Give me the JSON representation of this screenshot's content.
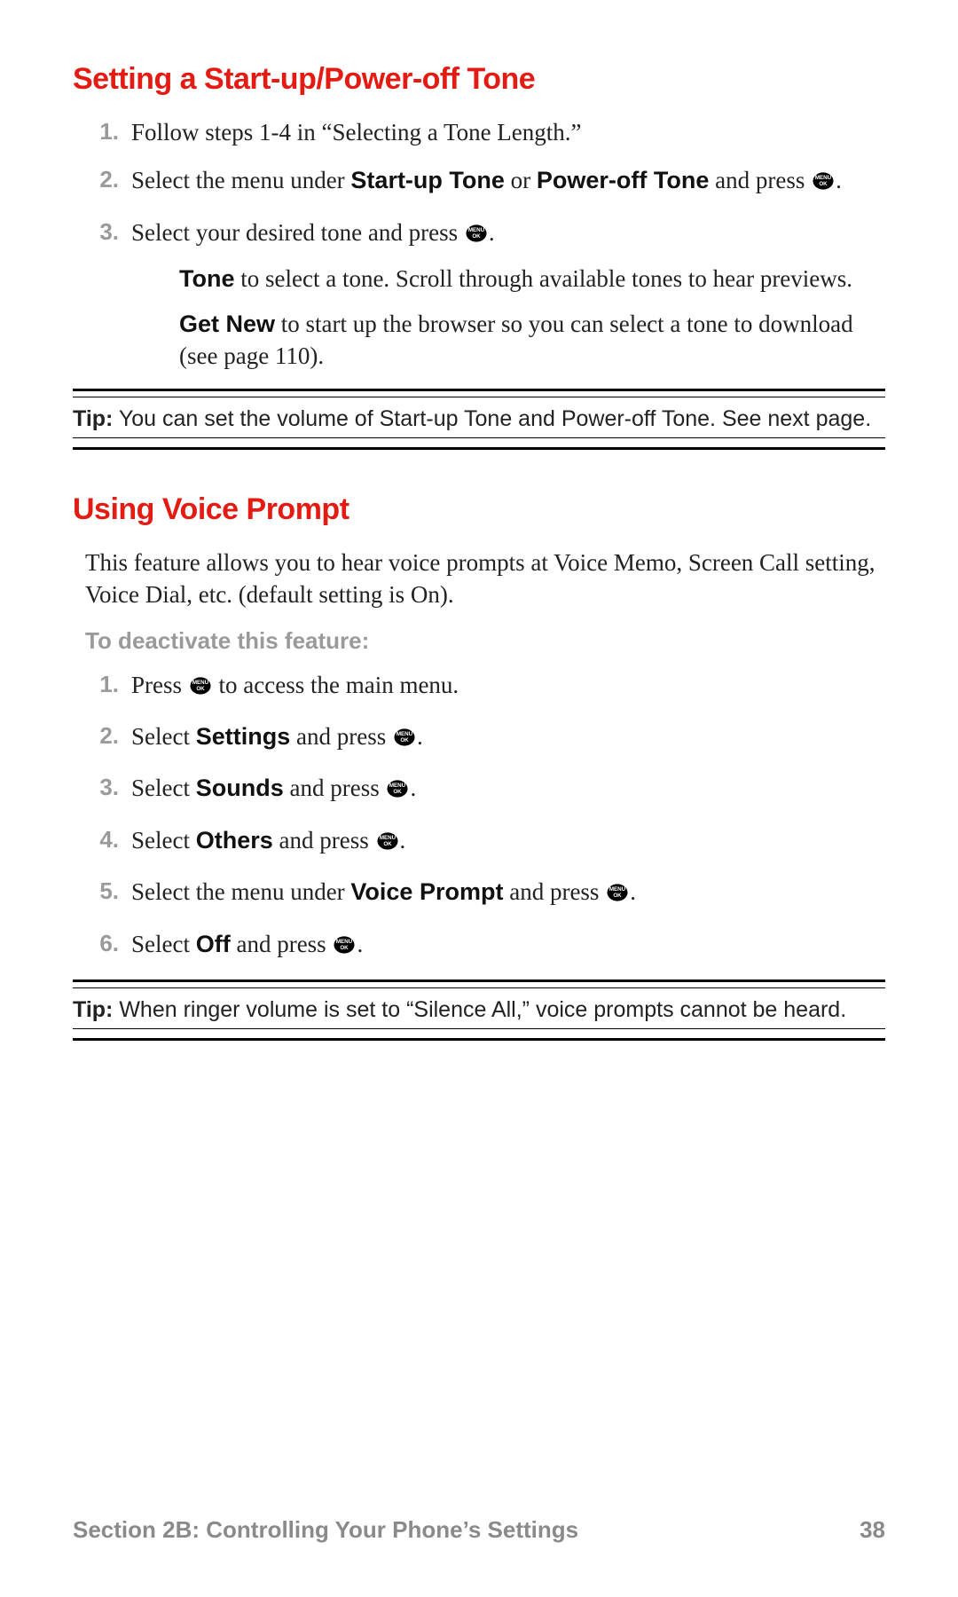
{
  "icons": {
    "menu_ok": "MENU OK"
  },
  "s1": {
    "heading": "Setting a Start-up/Power-off Tone",
    "items": [
      {
        "n": "1.",
        "t1": "Follow steps 1-4 in “Selecting a Tone Length.”"
      },
      {
        "n": "2.",
        "t1": "Select the menu under ",
        "b1": "Start-up Tone",
        "t2": " or ",
        "b2": "Power-off Tone",
        "t3": " and press ",
        "icon": true,
        "t4": "."
      },
      {
        "n": "3.",
        "t1": "Select your desired tone and press ",
        "icon": true,
        "t2": ".",
        "sub": [
          {
            "b": "Tone",
            "t": " to select a tone. Scroll through available tones to hear previews."
          },
          {
            "b": "Get New",
            "t": " to start up the browser so you can select a tone to download (see page 110)."
          }
        ]
      }
    ],
    "tip_label": "Tip:",
    "tip_text": " You can set the volume of Start-up Tone and Power-off Tone. See next page."
  },
  "s2": {
    "heading": "Using Voice Prompt",
    "intro": "This feature allows you to hear voice prompts at Voice Memo, Screen Call setting, Voice Dial, etc. (default setting is On).",
    "subhead": "To deactivate this feature:",
    "items": [
      {
        "n": "1.",
        "t1": "Press ",
        "icon": true,
        "t2": " to access the main menu."
      },
      {
        "n": "2.",
        "t1": "Select ",
        "b1": "Settings",
        "t2": " and press ",
        "icon": true,
        "t3": "."
      },
      {
        "n": "3.",
        "t1": "Select ",
        "b1": "Sounds",
        "t2": " and press ",
        "icon": true,
        "t3": "."
      },
      {
        "n": "4.",
        "t1": "Select ",
        "b1": "Others",
        "t2": " and press ",
        "icon": true,
        "t3": "."
      },
      {
        "n": "5.",
        "t1": "Select the menu under ",
        "b1": "Voice Prompt",
        "t2": " and press ",
        "icon": true,
        "t3": "."
      },
      {
        "n": "6.",
        "t1": "Select ",
        "b1": "Off",
        "t2": " and press ",
        "icon": true,
        "t3": "."
      }
    ],
    "tip_label": "Tip:",
    "tip_text": " When ringer volume is set to “Silence All,” voice prompts cannot be heard."
  },
  "footer": {
    "section": "Section 2B: Controlling Your Phone’s Settings",
    "page": "38"
  }
}
